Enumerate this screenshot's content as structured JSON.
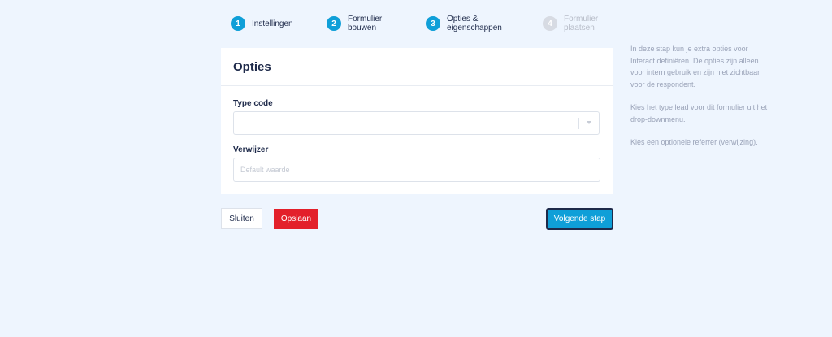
{
  "stepper": {
    "steps": [
      {
        "number": "1",
        "label": "Instellingen"
      },
      {
        "number": "2",
        "label": "Formulier\nbouwen"
      },
      {
        "number": "3",
        "label": "Opties &\neigenschappen"
      },
      {
        "number": "4",
        "label": "Formulier\nplaatsen"
      }
    ]
  },
  "card": {
    "title": "Opties",
    "type_code": {
      "label": "Type code",
      "value": ""
    },
    "referrer": {
      "label": "Verwijzer",
      "placeholder": "Default waarde",
      "value": ""
    }
  },
  "buttons": {
    "close": "Sluiten",
    "save": "Opslaan",
    "next": "Volgende stap"
  },
  "help": {
    "paragraphs": [
      "In deze stap kun je extra opties voor Interact definiëren. De opties zijn alleen voor intern gebruik en zijn niet zichtbaar voor de respondent.",
      "Kies het type lead voor dit formulier uit het drop-downmenu.",
      "Kies een optionele referrer (verwijzing)."
    ]
  },
  "colors": {
    "background": "#eef5fe",
    "accent": "#0f9fd8",
    "danger": "#e3202a",
    "text": "#1e2a4a",
    "muted": "#9aa3b8"
  }
}
